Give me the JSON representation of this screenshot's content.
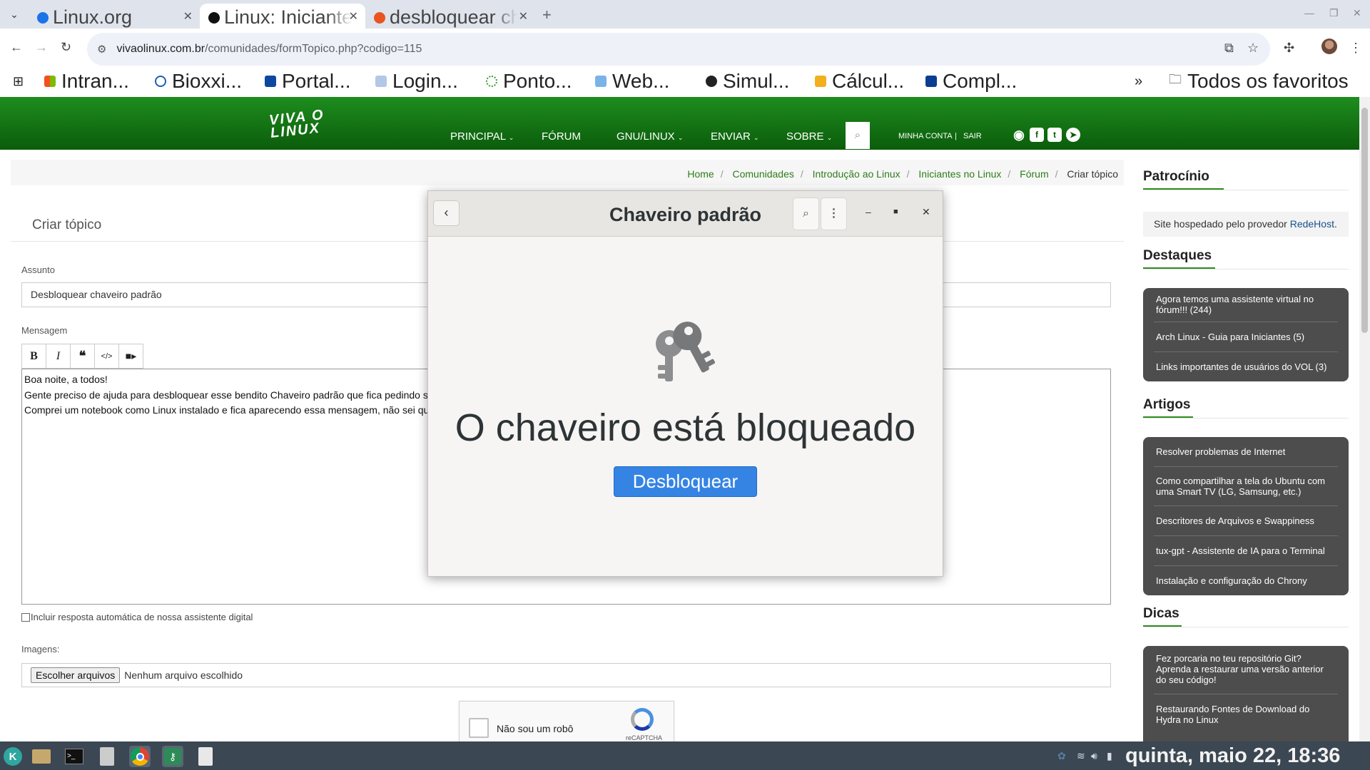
{
  "browser": {
    "tabs": [
      {
        "title": "Linux.org",
        "favicon_color": "#1a73e8"
      },
      {
        "title": "Linux: Iniciantes no Linux",
        "favicon_color": "#111111"
      },
      {
        "title": "desbloquear chaveiro",
        "favicon_color": "#e95420"
      }
    ],
    "active_tab_index": 1,
    "url_host": "vivaolinux.com.br",
    "url_path": "/comunidades/formTopico.php?codigo=115",
    "bookmarks": [
      "Intran...",
      "Bioxxi...",
      "Portal...",
      "Login...",
      "Ponto...",
      "Web...",
      "Simul...",
      "Cálcul...",
      "Compl..."
    ],
    "bookmarks_overflow": "»",
    "all_bookmarks": "Todos os favoritos"
  },
  "site": {
    "logo_line1": "VIVA O",
    "logo_line2": "LINUX",
    "menu": [
      "PRINCIPAL",
      "FÓRUM",
      "GNU/LINUX",
      "ENVIAR",
      "SOBRE"
    ],
    "account": "MINHA CONTA",
    "logout": "SAIR",
    "account_sep": "|",
    "brand_color": "#1e8d1e"
  },
  "breadcrumb": [
    "Home",
    "Comunidades",
    "Introdução ao Linux",
    "Iniciantes no Linux",
    "Fórum",
    "Criar tópico"
  ],
  "form": {
    "title": "Criar tópico",
    "subject_label": "Assunto",
    "subject_value": "Desbloquear chaveiro padrão",
    "message_label": "Mensagem",
    "message_lines": [
      "Boa noite, a todos!",
      "Gente preciso de ajuda para desbloquear esse bendito Chaveiro padrão que fica pedindo s",
      "Comprei um notebook como Linux instalado e fica aparecendo essa mensagem, não sei qu"
    ],
    "auto_reply_label": "Incluir resposta automática de nossa assistente digital",
    "images_label": "Imagens:",
    "choose_files": "Escolher arquivos",
    "no_file": "Nenhum arquivo escolhido",
    "captcha_label": "Não sou um robô",
    "captcha_brand": "reCAPTCHA"
  },
  "sidebar": {
    "sponsor_title": "Patrocínio",
    "sponsor_text": "Site hospedado pelo provedor",
    "sponsor_link": "RedeHost",
    "sponsor_period": ".",
    "highlights_title": "Destaques",
    "highlights": [
      "Agora temos uma assistente virtual no fórum!!! (244)",
      "Arch Linux - Guia para Iniciantes (5)",
      "Links importantes de usuários do VOL (3)"
    ],
    "articles_title": "Artigos",
    "articles": [
      "Resolver problemas de Internet",
      "Como compartilhar a tela do Ubuntu com uma Smart TV (LG, Samsung, etc.)",
      "Descritores de Arquivos e Swappiness",
      "tux-gpt - Assistente de IA para o Terminal",
      "Instalação e configuração do Chrony"
    ],
    "tips_title": "Dicas",
    "tips": [
      "Fez porcaria no teu repositório Git? Aprenda a restaurar uma versão anterior do seu código!",
      "Restaurando Fontes de Download do Hydra no Linux"
    ]
  },
  "dialog": {
    "title": "Chaveiro padrão",
    "message": "O chaveiro está bloqueado",
    "unlock_button": "Desbloquear",
    "accent_color": "#3584e4"
  },
  "taskbar": {
    "clock": "quinta, maio 22, 18:36"
  }
}
